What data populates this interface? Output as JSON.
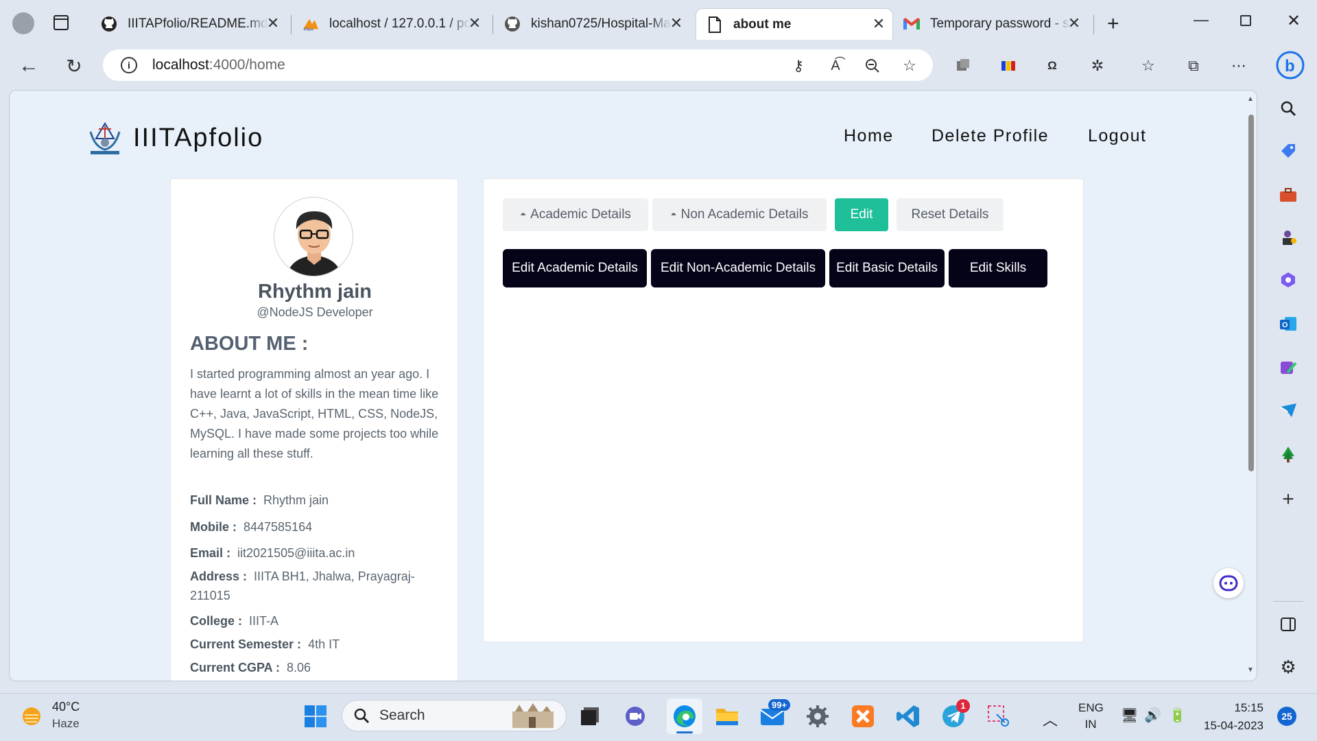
{
  "browser": {
    "tabs": [
      {
        "title": "IIITAPfolio/README.md",
        "icon": "github-icon",
        "active": false
      },
      {
        "title": "localhost / 127.0.0.1 / pc",
        "icon": "phpmyadmin-icon",
        "active": false
      },
      {
        "title": "kishan0725/Hospital-Ma",
        "icon": "github-icon",
        "active": false
      },
      {
        "title": "about me",
        "icon": "page-icon",
        "active": true
      },
      {
        "title": "Temporary password - sl",
        "icon": "gmail-icon",
        "active": false
      }
    ],
    "url_host": "localhost",
    "url_path": ":4000/home"
  },
  "site": {
    "brand": "IIITApfolio",
    "nav": [
      "Home",
      "Delete Profile",
      "Logout"
    ]
  },
  "profile": {
    "name": "Rhythm jain",
    "role": "@NodeJS Developer",
    "about_heading": "ABOUT ME :",
    "about_text": "I started programming almost an year ago. I have learnt a lot of skills in the mean time like C++, Java, JavaScript, HTML, CSS, NodeJS, MySQL. I have made some projects too while learning all these stuff.",
    "fields": [
      {
        "label": "Full Name :",
        "value": "Rhythm jain"
      },
      {
        "label": "Mobile :",
        "value": "8447585164"
      },
      {
        "label": "Email :",
        "value": "iit2021505@iiita.ac.in"
      },
      {
        "label": "Address :",
        "value": "IIITA BH1, Jhalwa, Prayagraj-211015"
      },
      {
        "label": "College :",
        "value": "IIIT-A"
      },
      {
        "label": "Current Semester :",
        "value": "4th IT"
      },
      {
        "label": "Current CGPA :",
        "value": "8.06"
      }
    ]
  },
  "tabs": [
    "Academic Details",
    "Non Academic Details",
    "Edit",
    "Reset Details"
  ],
  "edit_buttons": [
    "Edit Academic Details",
    "Edit Non-Academic Details",
    "Edit Basic Details",
    "Edit Skills"
  ],
  "taskbar": {
    "weather_temp": "40°C",
    "weather_desc": "Haze",
    "search_label": "Search",
    "mail_badge": "99+",
    "telegram_badge": "1",
    "lang_top": "ENG",
    "lang_bottom": "IN",
    "time": "15:15",
    "date": "15-04-2023",
    "notif_count": "25"
  },
  "colors": {
    "accent_green": "#1fbf9a",
    "dark_button": "#040318"
  }
}
